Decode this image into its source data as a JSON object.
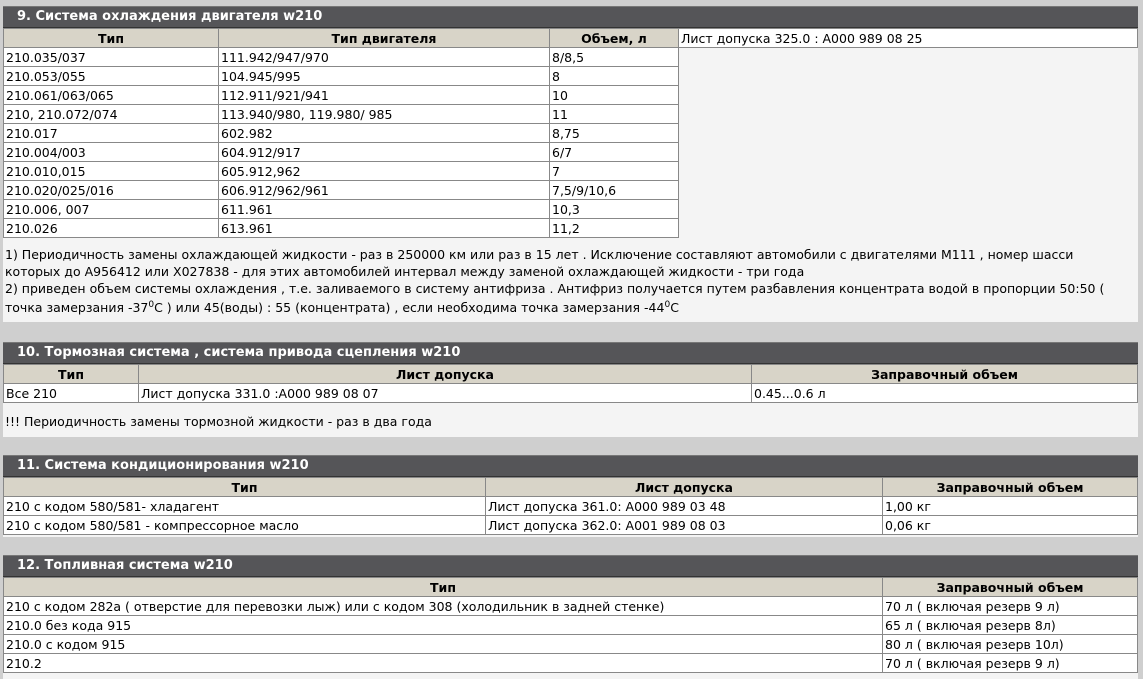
{
  "s9": {
    "title": "9. Система охлаждения двигателя w210",
    "headers": [
      "Тип",
      "Тип двигателя",
      "Объем, л"
    ],
    "rows": [
      [
        "210.035/037",
        "111.942/947/970",
        "8/8,5"
      ],
      [
        "210.053/055",
        "104.945/995",
        "8"
      ],
      [
        "210.061/063/065",
        "112.911/921/941",
        "10"
      ],
      [
        "210, 210.072/074",
        "113.940/980, 119.980/ 985",
        "11"
      ],
      [
        "210.017",
        "602.982",
        "8,75"
      ],
      [
        "210.004/003",
        "604.912/917",
        "6/7"
      ],
      [
        "210.010,015",
        "605.912,962",
        "7"
      ],
      [
        "210.020/025/016",
        "606.912/962/961",
        "7,5/9/10,6"
      ],
      [
        "210.006, 007",
        "611.961",
        "10,3"
      ],
      [
        "210.026",
        "613.961",
        "11,2"
      ]
    ],
    "approval": "Лист допуска 325.0 : А000 989 08 25",
    "note1_line1": "1) Периодичность замены охлаждающей жидкости - раз в 250000 км или раз в 15 лет . Исключение составляют автомобили с двигателями М111 , номер шасси",
    "note1_line2": "которых до А956412 или Х027838 - для этих автомобилей интервал между заменой охлаждающей жидкости - три года",
    "note2_line1": "2) приведен объем системы охлаждения , т.е. заливаемого в систему антифриза . Антифриз получается путем разбавления концентрата водой в пропорции 50:50 (",
    "note2_line2_a": "точка замерзания -37",
    "note2_sup1": "0",
    "note2_line2_b": "С ) или 45(воды) : 55 (концентрата) , если необходима точка замерзания -44",
    "note2_sup2": "0",
    "note2_line2_c": "С"
  },
  "s10": {
    "title": "10. Тормозная система , система привода сцепления w210",
    "headers": [
      "Тип",
      "Лист допуска",
      "Заправочный объем"
    ],
    "rows": [
      [
        "Все 210",
        "Лист допуска 331.0 :А000 989 08 07",
        "0.45...0.6 л"
      ]
    ],
    "note": "!!! Периодичность замены тормозной жидкости - раз в два года"
  },
  "s11": {
    "title": "11. Система кондиционирования w210",
    "headers": [
      "Тип",
      "Лист допуска",
      "Заправочный объем"
    ],
    "rows": [
      [
        "210 с кодом 580/581- хладагент",
        "Лист допуска 361.0: А000 989 03 48",
        "1,00 кг"
      ],
      [
        "210 с кодом 580/581 - компрессорное масло",
        "Лист допуска 362.0: А001 989 08 03",
        "0,06 кг"
      ]
    ]
  },
  "s12": {
    "title": "12. Топливная система w210",
    "headers": [
      "Тип",
      "Заправочный объем"
    ],
    "rows": [
      [
        "210 с кодом 282а ( отверстие для перевозки лыж) или с кодом 308 (холодильник в задней стенке)",
        "70 л ( включая резерв 9 л)"
      ],
      [
        "210.0 без кода 915",
        "65 л ( включая резерв 8л)"
      ],
      [
        "210.0 с кодом 915",
        "80 л ( включая резерв 10л)"
      ],
      [
        "210.2",
        "70 л ( включая резерв 9 л)"
      ]
    ]
  }
}
